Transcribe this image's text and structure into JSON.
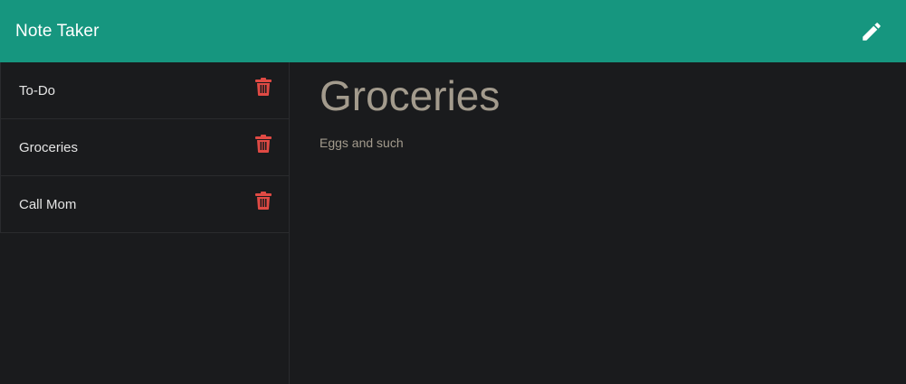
{
  "app": {
    "title": "Note Taker"
  },
  "header": {
    "new_note_icon": "pencil-icon",
    "background_color": "#16967f"
  },
  "sidebar": {
    "notes": [
      {
        "title": "To-Do",
        "delete_icon": "trash-icon"
      },
      {
        "title": "Groceries",
        "delete_icon": "trash-icon"
      },
      {
        "title": "Call Mom",
        "delete_icon": "trash-icon"
      }
    ],
    "delete_color": "#e04a44"
  },
  "active_note": {
    "title": "Groceries",
    "text": "Eggs and such"
  }
}
